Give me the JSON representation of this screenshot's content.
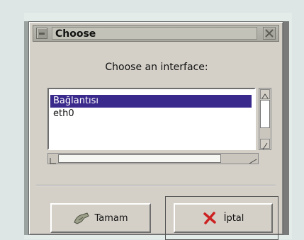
{
  "dialog": {
    "title": "Choose",
    "prompt": "Choose an interface:",
    "interfaces": [
      "Bağlantısı",
      "eth0"
    ],
    "selected_index": 0,
    "ok_label": "Tamam",
    "cancel_label": "İptal"
  },
  "icons": {
    "window_menu": "window-menu-icon",
    "close": "close-icon",
    "ok": "handshake-icon",
    "cancel": "red-x-icon"
  },
  "colors": {
    "selection": "#3a2a8c",
    "dialog_bg": "#d4d0c8",
    "cancel_icon": "#cc2222"
  }
}
